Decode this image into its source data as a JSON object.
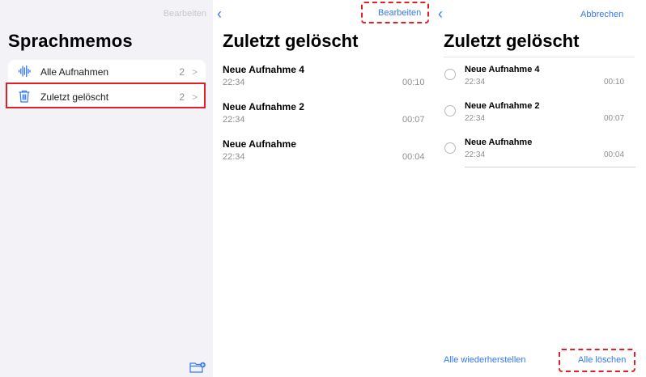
{
  "sidebar": {
    "edit_label": "Bearbeiten",
    "title": "Sprachmemos",
    "items": [
      {
        "label": "Alle Aufnahmen",
        "count": "2",
        "icon": "waveform-icon"
      },
      {
        "label": "Zuletzt gelöscht",
        "count": "2",
        "icon": "trash-icon"
      }
    ],
    "bottom_icon": "new-folder-icon"
  },
  "middle": {
    "back_glyph": "‹",
    "edit_label": "Bearbeiten",
    "title": "Zuletzt gelöscht",
    "recordings": [
      {
        "name": "Neue Aufnahme 4",
        "time": "22:34",
        "duration": "00:10"
      },
      {
        "name": "Neue Aufnahme 2",
        "time": "22:34",
        "duration": "00:07"
      },
      {
        "name": "Neue Aufnahme",
        "time": "22:34",
        "duration": "00:04"
      }
    ]
  },
  "right": {
    "back_glyph": "‹",
    "cancel_label": "Abbrechen",
    "title": "Zuletzt gelöscht",
    "recordings": [
      {
        "name": "Neue Aufnahme 4",
        "time": "22:34",
        "duration": "00:10"
      },
      {
        "name": "Neue Aufnahme 2",
        "time": "22:34",
        "duration": "00:07"
      },
      {
        "name": "Neue Aufnahme",
        "time": "22:34",
        "duration": "00:04"
      }
    ],
    "restore_all_label": "Alle wiederherstellen",
    "delete_all_label": "Alle löschen"
  },
  "colors": {
    "accent": "#3478f6",
    "highlight": "#e41e26",
    "sidebar_bg": "#f2f2f7"
  }
}
